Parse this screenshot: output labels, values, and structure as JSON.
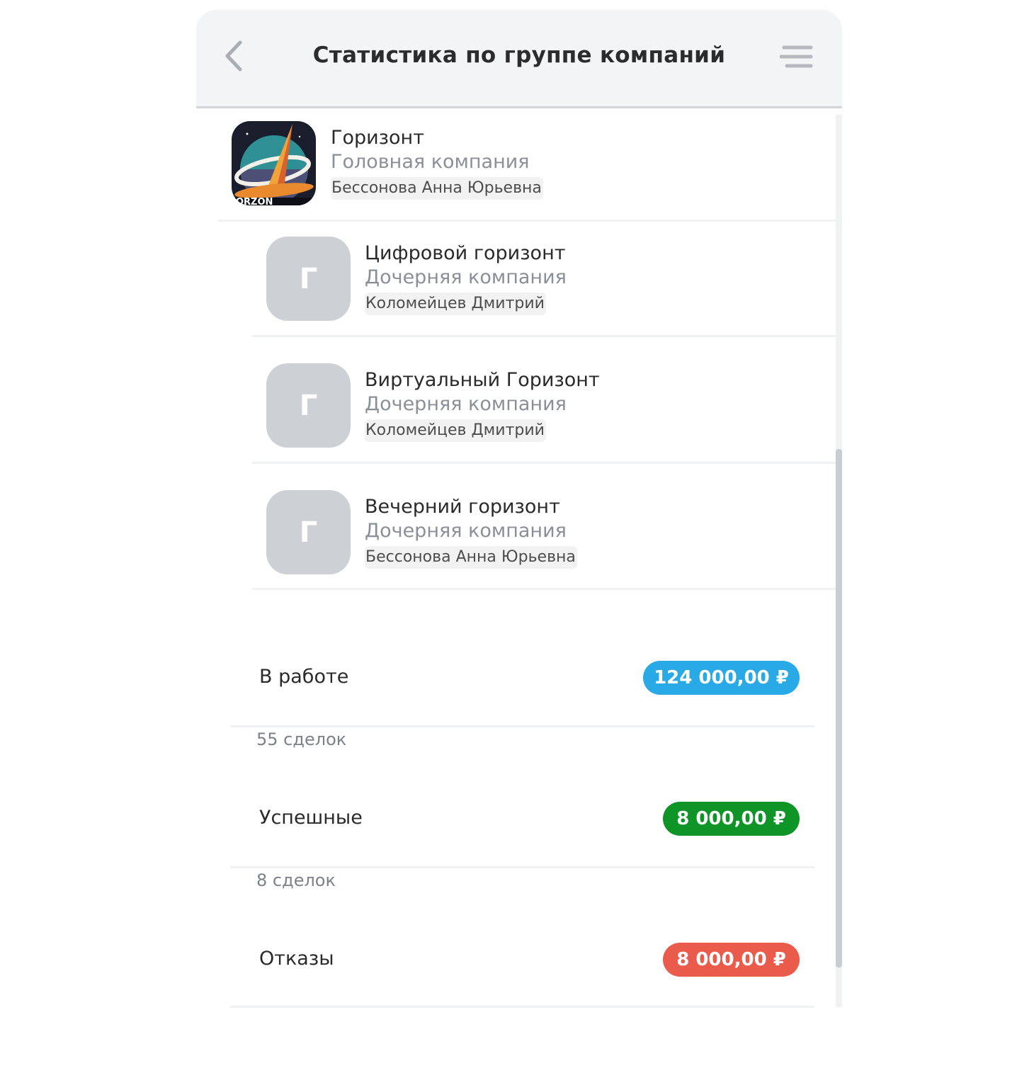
{
  "header": {
    "title": "Статистика по группе компаний",
    "back_icon": "chevron-left-icon",
    "menu_icon": "menu-icon"
  },
  "companies": [
    {
      "name": "Горизонт",
      "type": "Головная компания",
      "owner": "Бессонова Анна Юрьевна",
      "logo": "horizon-logo"
    },
    {
      "name": "Цифровой горизонт",
      "type": "Дочерняя компания",
      "owner": "Коломейцев Дмитрий",
      "initial": "Г"
    },
    {
      "name": "Виртуальный Горизонт",
      "type": "Дочерняя компания",
      "owner": "Коломейцев Дмитрий",
      "initial": "Г"
    },
    {
      "name": "Вечерний горизонт",
      "type": "Дочерняя компания",
      "owner": "Бессонова Анна Юрьевна",
      "initial": "Г"
    }
  ],
  "stats": [
    {
      "label": "В работе",
      "amount": "124 000,00 ₽",
      "count": "55 сделок",
      "color": "#29a9e6"
    },
    {
      "label": "Успешные",
      "amount": "8 000,00 ₽",
      "count": "8 сделок",
      "color": "#0f9427"
    },
    {
      "label": "Отказы",
      "amount": "8 000,00 ₽",
      "count": "",
      "color": "#ea5b4b"
    }
  ],
  "colors": {
    "header_bg": "#f3f4f6",
    "avatar_bg": "#cdd0d5",
    "secondary_text": "#8a8f99"
  }
}
